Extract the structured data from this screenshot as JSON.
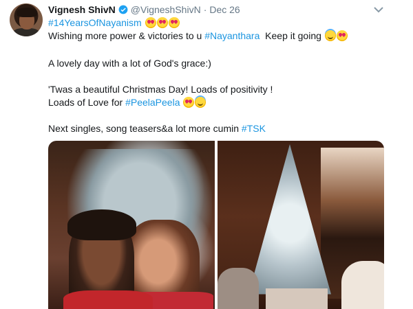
{
  "tweet": {
    "display_name": "Vignesh ShivN",
    "handle": "@VigneshShivN",
    "separator": "·",
    "date": "Dec 26",
    "line1": {
      "hashtag": "#14YearsOfNayanism"
    },
    "line2": {
      "text": "Wishing more power & victories to u ",
      "mention": "#Nayanthara",
      "after": "  Keep it going "
    },
    "line3": "A lovely day with a lot of God's grace:)",
    "line4": "'Twas a beautiful Christmas Day! Loads of positivity !",
    "line5": {
      "text": "Loads of Love for ",
      "hashtag": "#PeelaPeela"
    },
    "line6": {
      "text": "Next singles, song teasers&a lot more cumin ",
      "hashtag": "#TSK"
    }
  },
  "colors": {
    "link": "#1b95e0",
    "verified": "#1da1f2",
    "muted": "#657786"
  },
  "icons": {
    "verified": "verified-badge-icon",
    "menu": "chevron-down-icon"
  }
}
